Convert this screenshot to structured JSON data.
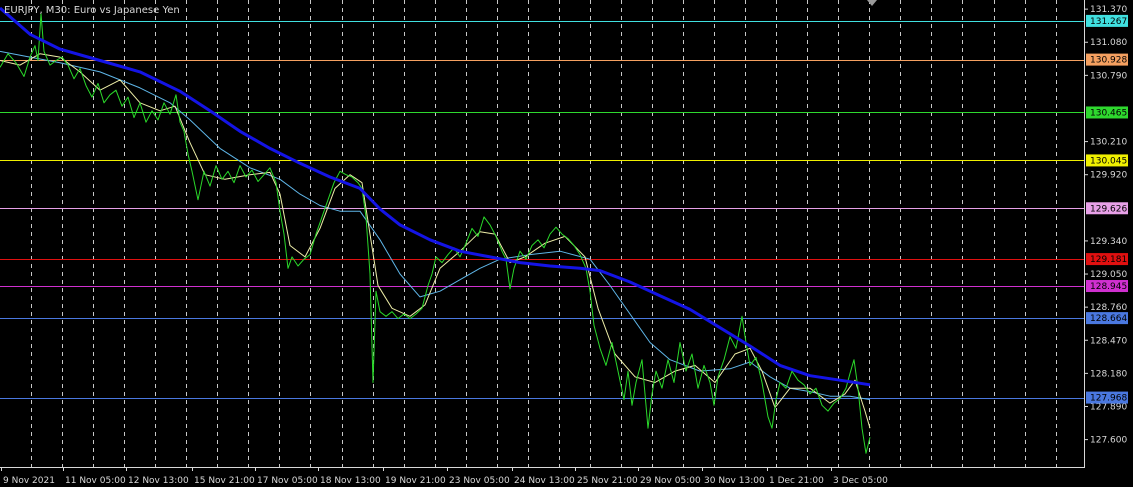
{
  "title": "EURJPY, M30:  Euro vs Japanese Yen",
  "colors": {
    "background": "#000000",
    "axis": "#d8d8d8",
    "grid": "#c8c8c8",
    "price": "#2ad92a",
    "ma_fast": "#eeeea8",
    "ma_mid": "#5fb6e8",
    "ma_slow": "#1414e6"
  },
  "chart_data": {
    "type": "line",
    "symbol": "EURJPY",
    "timeframe": "M30",
    "ylim": [
      127.36,
      131.45
    ],
    "grid": "dashed",
    "y_ticks": [
      131.37,
      131.08,
      130.79,
      130.21,
      129.92,
      129.34,
      129.05,
      128.76,
      128.47,
      128.18,
      127.89,
      127.6
    ],
    "x_ticks": [
      "9 Nov 2021",
      "11 Nov 05:00",
      "12 Nov 13:00",
      "15 Nov 21:00",
      "17 Nov 05:00",
      "18 Nov 13:00",
      "19 Nov 21:00",
      "23 Nov 05:00",
      "24 Nov 13:00",
      "25 Nov 21:00",
      "29 Nov 05:00",
      "30 Nov 13:00",
      "1 Dec 21:00",
      "3 Dec 05:00"
    ],
    "levels": [
      {
        "value": 131.267,
        "label": "131.267",
        "color": "#40e0e0",
        "text_color": "#000000"
      },
      {
        "value": 130.928,
        "label": "130.928",
        "color": "#f5a060",
        "text_color": "#000000"
      },
      {
        "value": 130.465,
        "label": "130.465",
        "color": "#2ed82e",
        "text_color": "#000000"
      },
      {
        "value": 130.045,
        "label": "130.045",
        "color": "#f0f000",
        "text_color": "#000000"
      },
      {
        "value": 129.626,
        "label": "129.626",
        "color": "#e7a0e7",
        "text_color": "#000000"
      },
      {
        "value": 129.181,
        "label": "129.181",
        "color": "#e01010",
        "text_color": "#000000"
      },
      {
        "value": 128.945,
        "label": "128.945",
        "color": "#d030d0",
        "text_color": "#000000"
      },
      {
        "value": 128.664,
        "label": "128.664",
        "color": "#4a78e0",
        "text_color": "#000000"
      },
      {
        "value": 127.968,
        "label": "127.968",
        "color": "#4a78e0",
        "text_color": "#000000"
      }
    ],
    "series": [
      {
        "key": "price",
        "color": "#2ad92a",
        "values": [
          [
            0,
            130.86
          ],
          [
            8,
            130.98
          ],
          [
            16,
            130.9
          ],
          [
            24,
            130.78
          ],
          [
            30,
            130.95
          ],
          [
            35,
            131.05
          ],
          [
            38,
            130.92
          ],
          [
            41,
            131.33
          ],
          [
            44,
            131.0
          ],
          [
            50,
            130.88
          ],
          [
            56,
            130.92
          ],
          [
            62,
            130.95
          ],
          [
            68,
            130.88
          ],
          [
            74,
            130.76
          ],
          [
            80,
            130.85
          ],
          [
            86,
            130.7
          ],
          [
            92,
            130.6
          ],
          [
            98,
            130.72
          ],
          [
            104,
            130.55
          ],
          [
            110,
            130.62
          ],
          [
            116,
            130.66
          ],
          [
            122,
            130.52
          ],
          [
            128,
            130.6
          ],
          [
            134,
            130.42
          ],
          [
            140,
            130.55
          ],
          [
            146,
            130.38
          ],
          [
            152,
            130.48
          ],
          [
            158,
            130.4
          ],
          [
            164,
            130.55
          ],
          [
            170,
            130.45
          ],
          [
            176,
            130.62
          ],
          [
            180,
            130.38
          ],
          [
            184,
            130.3
          ],
          [
            188,
            130.1
          ],
          [
            192,
            129.95
          ],
          [
            198,
            129.7
          ],
          [
            204,
            129.95
          ],
          [
            210,
            129.82
          ],
          [
            216,
            130.0
          ],
          [
            222,
            129.88
          ],
          [
            228,
            129.95
          ],
          [
            234,
            129.85
          ],
          [
            240,
            130.0
          ],
          [
            246,
            129.9
          ],
          [
            252,
            129.96
          ],
          [
            258,
            129.86
          ],
          [
            264,
            129.92
          ],
          [
            270,
            129.98
          ],
          [
            276,
            129.85
          ],
          [
            280,
            129.6
          ],
          [
            284,
            129.4
          ],
          [
            288,
            129.1
          ],
          [
            292,
            129.2
          ],
          [
            298,
            129.12
          ],
          [
            304,
            129.18
          ],
          [
            310,
            129.22
          ],
          [
            316,
            129.4
          ],
          [
            322,
            129.55
          ],
          [
            328,
            129.7
          ],
          [
            334,
            129.85
          ],
          [
            340,
            129.95
          ],
          [
            346,
            129.92
          ],
          [
            352,
            129.9
          ],
          [
            358,
            129.85
          ],
          [
            362,
            129.8
          ],
          [
            366,
            129.55
          ],
          [
            370,
            129.05
          ],
          [
            373,
            128.1
          ],
          [
            376,
            128.9
          ],
          [
            380,
            128.72
          ],
          [
            386,
            128.68
          ],
          [
            392,
            128.72
          ],
          [
            398,
            128.66
          ],
          [
            404,
            128.7
          ],
          [
            410,
            128.66
          ],
          [
            416,
            128.7
          ],
          [
            422,
            128.75
          ],
          [
            428,
            128.95
          ],
          [
            432,
            129.05
          ],
          [
            436,
            129.2
          ],
          [
            442,
            129.15
          ],
          [
            448,
            129.22
          ],
          [
            454,
            129.28
          ],
          [
            460,
            129.2
          ],
          [
            466,
            129.32
          ],
          [
            472,
            129.45
          ],
          [
            478,
            129.38
          ],
          [
            484,
            129.55
          ],
          [
            490,
            129.48
          ],
          [
            496,
            129.38
          ],
          [
            502,
            129.25
          ],
          [
            506,
            129.18
          ],
          [
            510,
            128.92
          ],
          [
            514,
            129.1
          ],
          [
            520,
            129.25
          ],
          [
            526,
            129.18
          ],
          [
            532,
            129.3
          ],
          [
            538,
            129.35
          ],
          [
            544,
            129.28
          ],
          [
            550,
            129.4
          ],
          [
            556,
            129.46
          ],
          [
            562,
            129.4
          ],
          [
            568,
            129.36
          ],
          [
            574,
            129.3
          ],
          [
            580,
            129.22
          ],
          [
            586,
            129.1
          ],
          [
            590,
            128.9
          ],
          [
            594,
            128.6
          ],
          [
            600,
            128.4
          ],
          [
            606,
            128.25
          ],
          [
            612,
            128.45
          ],
          [
            618,
            128.2
          ],
          [
            624,
            127.95
          ],
          [
            628,
            128.2
          ],
          [
            632,
            127.9
          ],
          [
            636,
            128.1
          ],
          [
            642,
            128.3
          ],
          [
            648,
            127.7
          ],
          [
            652,
            128.0
          ],
          [
            656,
            128.2
          ],
          [
            662,
            128.05
          ],
          [
            668,
            128.3
          ],
          [
            674,
            128.1
          ],
          [
            680,
            128.45
          ],
          [
            686,
            128.2
          ],
          [
            692,
            128.35
          ],
          [
            698,
            128.05
          ],
          [
            704,
            128.25
          ],
          [
            710,
            128.1
          ],
          [
            714,
            127.9
          ],
          [
            718,
            128.15
          ],
          [
            724,
            128.3
          ],
          [
            730,
            128.5
          ],
          [
            736,
            128.4
          ],
          [
            742,
            128.68
          ],
          [
            746,
            128.45
          ],
          [
            750,
            128.25
          ],
          [
            756,
            128.32
          ],
          [
            762,
            128.1
          ],
          [
            768,
            127.8
          ],
          [
            772,
            127.7
          ],
          [
            776,
            127.95
          ],
          [
            780,
            128.1
          ],
          [
            786,
            128.05
          ],
          [
            792,
            128.2
          ],
          [
            798,
            128.12
          ],
          [
            804,
            128.08
          ],
          [
            810,
            128.0
          ],
          [
            816,
            128.05
          ],
          [
            822,
            127.9
          ],
          [
            828,
            127.85
          ],
          [
            834,
            127.92
          ],
          [
            840,
            127.96
          ],
          [
            846,
            128.05
          ],
          [
            850,
            128.18
          ],
          [
            854,
            128.3
          ],
          [
            858,
            128.05
          ],
          [
            862,
            127.7
          ],
          [
            866,
            127.48
          ],
          [
            870,
            127.62
          ]
        ]
      },
      {
        "key": "ma_fast",
        "color": "#eeeea8",
        "values": [
          [
            0,
            130.92
          ],
          [
            20,
            130.88
          ],
          [
            40,
            130.98
          ],
          [
            60,
            130.95
          ],
          [
            80,
            130.82
          ],
          [
            100,
            130.66
          ],
          [
            120,
            130.75
          ],
          [
            140,
            130.55
          ],
          [
            160,
            130.48
          ],
          [
            175,
            130.52
          ],
          [
            190,
            130.2
          ],
          [
            205,
            129.92
          ],
          [
            225,
            129.88
          ],
          [
            250,
            129.92
          ],
          [
            270,
            129.94
          ],
          [
            280,
            129.75
          ],
          [
            290,
            129.3
          ],
          [
            305,
            129.2
          ],
          [
            320,
            129.45
          ],
          [
            335,
            129.8
          ],
          [
            350,
            129.92
          ],
          [
            362,
            129.85
          ],
          [
            370,
            129.4
          ],
          [
            378,
            128.95
          ],
          [
            392,
            128.75
          ],
          [
            410,
            128.68
          ],
          [
            425,
            128.78
          ],
          [
            440,
            129.1
          ],
          [
            460,
            129.25
          ],
          [
            480,
            129.42
          ],
          [
            495,
            129.4
          ],
          [
            510,
            129.15
          ],
          [
            525,
            129.2
          ],
          [
            545,
            129.32
          ],
          [
            565,
            129.38
          ],
          [
            585,
            129.2
          ],
          [
            598,
            128.75
          ],
          [
            615,
            128.35
          ],
          [
            635,
            128.15
          ],
          [
            655,
            128.1
          ],
          [
            675,
            128.2
          ],
          [
            695,
            128.25
          ],
          [
            715,
            128.1
          ],
          [
            735,
            128.35
          ],
          [
            750,
            128.4
          ],
          [
            762,
            128.2
          ],
          [
            775,
            127.88
          ],
          [
            790,
            128.05
          ],
          [
            810,
            128.05
          ],
          [
            830,
            127.92
          ],
          [
            845,
            128.0
          ],
          [
            855,
            128.12
          ],
          [
            865,
            127.85
          ],
          [
            870,
            127.7
          ]
        ]
      },
      {
        "key": "ma_mid",
        "color": "#5fb6e8",
        "values": [
          [
            0,
            131.0
          ],
          [
            30,
            130.95
          ],
          [
            60,
            130.9
          ],
          [
            100,
            130.82
          ],
          [
            140,
            130.68
          ],
          [
            170,
            130.55
          ],
          [
            190,
            130.4
          ],
          [
            220,
            130.15
          ],
          [
            250,
            129.98
          ],
          [
            280,
            129.88
          ],
          [
            300,
            129.75
          ],
          [
            320,
            129.65
          ],
          [
            340,
            129.6
          ],
          [
            360,
            129.6
          ],
          [
            380,
            129.35
          ],
          [
            400,
            129.05
          ],
          [
            420,
            128.85
          ],
          [
            440,
            128.9
          ],
          [
            460,
            129.0
          ],
          [
            480,
            129.1
          ],
          [
            500,
            129.18
          ],
          [
            530,
            129.22
          ],
          [
            560,
            129.25
          ],
          [
            590,
            129.18
          ],
          [
            610,
            128.95
          ],
          [
            630,
            128.7
          ],
          [
            650,
            128.45
          ],
          [
            670,
            128.3
          ],
          [
            700,
            128.2
          ],
          [
            730,
            128.22
          ],
          [
            750,
            128.28
          ],
          [
            770,
            128.15
          ],
          [
            790,
            128.05
          ],
          [
            810,
            128.02
          ],
          [
            830,
            127.98
          ],
          [
            850,
            127.98
          ],
          [
            870,
            127.95
          ]
        ]
      },
      {
        "key": "ma_slow",
        "color": "#1414e6",
        "values": [
          [
            0,
            131.38
          ],
          [
            30,
            131.15
          ],
          [
            60,
            131.02
          ],
          [
            100,
            130.92
          ],
          [
            140,
            130.82
          ],
          [
            180,
            130.65
          ],
          [
            210,
            130.48
          ],
          [
            240,
            130.3
          ],
          [
            270,
            130.15
          ],
          [
            300,
            130.02
          ],
          [
            330,
            129.9
          ],
          [
            360,
            129.8
          ],
          [
            380,
            129.62
          ],
          [
            400,
            129.48
          ],
          [
            430,
            129.35
          ],
          [
            460,
            129.25
          ],
          [
            490,
            129.2
          ],
          [
            520,
            129.15
          ],
          [
            550,
            129.12
          ],
          [
            580,
            129.1
          ],
          [
            600,
            129.08
          ],
          [
            630,
            128.98
          ],
          [
            660,
            128.86
          ],
          [
            690,
            128.74
          ],
          [
            720,
            128.58
          ],
          [
            750,
            128.42
          ],
          [
            780,
            128.25
          ],
          [
            810,
            128.16
          ],
          [
            840,
            128.12
          ],
          [
            870,
            128.08
          ]
        ]
      }
    ]
  }
}
